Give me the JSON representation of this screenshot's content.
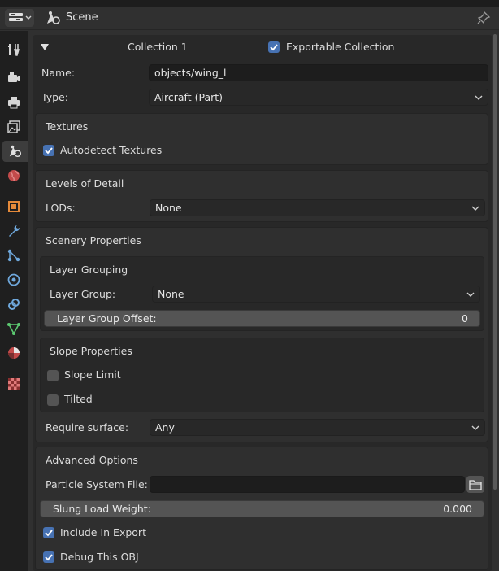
{
  "header": {
    "title": "Scene"
  },
  "collection": {
    "name": "Collection 1",
    "exportable_label": "Exportable Collection",
    "exportable_checked": true,
    "name_label": "Name:",
    "name_value": "objects/wing_l",
    "type_label": "Type:",
    "type_value": "Aircraft (Part)"
  },
  "textures": {
    "heading": "Textures",
    "autodetect_label": "Autodetect Textures",
    "autodetect_checked": true
  },
  "lods": {
    "heading": "Levels of Detail",
    "lods_label": "LODs:",
    "lods_value": "None"
  },
  "scenery": {
    "heading": "Scenery Properties",
    "layer_grouping": {
      "heading": "Layer Grouping",
      "group_label": "Layer Group:",
      "group_value": "None",
      "offset_label": "Layer Group Offset:",
      "offset_value": "0"
    },
    "slope": {
      "heading": "Slope Properties",
      "slope_limit_label": "Slope Limit",
      "slope_limit_checked": false,
      "tilted_label": "Tilted",
      "tilted_checked": false
    },
    "surface_label": "Require surface:",
    "surface_value": "Any"
  },
  "advanced": {
    "heading": "Advanced Options",
    "particle_label": "Particle System File:",
    "particle_value": "",
    "slung_label": "Slung Load Weight:",
    "slung_value": "0.000",
    "include_label": "Include In Export",
    "include_checked": true,
    "debug_label": "Debug This OBJ",
    "debug_checked": true
  },
  "colors": {
    "accent": "#4772b3",
    "panel_bg": "#282828",
    "field_bg": "#1d1d1d"
  },
  "icons": [
    "editor-type-icon",
    "scene-icon",
    "pin-icon",
    "tool-icon",
    "render-icon",
    "output-icon",
    "view-layer-icon",
    "scene-tab-icon",
    "world-icon",
    "object-icon",
    "modifier-icon",
    "particles-icon",
    "physics-icon",
    "constraints-icon",
    "data-icon",
    "material-icon",
    "texture-icon",
    "chevron-down-icon",
    "folder-icon",
    "checkmark-icon"
  ]
}
